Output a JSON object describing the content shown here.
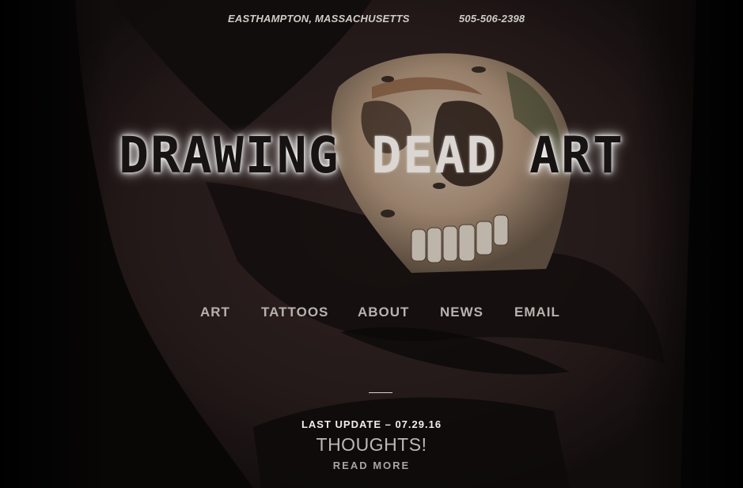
{
  "header": {
    "location": "EASTHAMPTON, MASSACHUSETTS",
    "phone": "505-506-2398"
  },
  "site_title": {
    "part1": "DRAWING ",
    "part2": "DEAD",
    "part3": " ART"
  },
  "nav": {
    "items": [
      {
        "label": "ART"
      },
      {
        "label": "TATTOOS"
      },
      {
        "label": "ABOUT"
      },
      {
        "label": "NEWS"
      },
      {
        "label": "EMAIL"
      }
    ]
  },
  "post": {
    "last_update": "LAST UPDATE – 07.29.16",
    "title": "THOUGHTS!",
    "read_more": "READ MORE"
  },
  "colors": {
    "background": "#0c0909",
    "nav_text": "#b7b2ae",
    "header_text": "#cfcbc6"
  }
}
